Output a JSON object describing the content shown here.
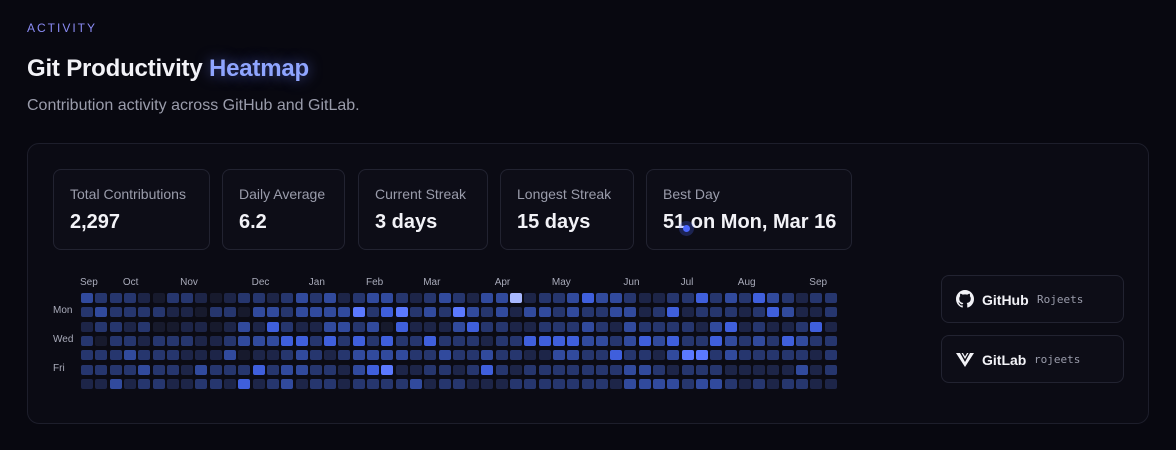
{
  "header": {
    "eyebrow": "ACTIVITY",
    "title_main": "Git Productivity",
    "title_accent": "Heatmap",
    "subtitle": "Contribution activity across GitHub and GitLab."
  },
  "stats": [
    {
      "label": "Total Contributions",
      "value": "2,297"
    },
    {
      "label": "Daily Average",
      "value": "6.2"
    },
    {
      "label": "Current Streak",
      "value": "3 days"
    },
    {
      "label": "Longest Streak",
      "value": "15 days"
    },
    {
      "label": "Best Day",
      "value": "51 on Mon, Mar 16"
    }
  ],
  "heatmap": {
    "months": [
      {
        "label": "Sep",
        "week": 0
      },
      {
        "label": "Oct",
        "week": 3
      },
      {
        "label": "Nov",
        "week": 7
      },
      {
        "label": "Dec",
        "week": 12
      },
      {
        "label": "Jan",
        "week": 16
      },
      {
        "label": "Feb",
        "week": 20
      },
      {
        "label": "Mar",
        "week": 24
      },
      {
        "label": "Apr",
        "week": 29
      },
      {
        "label": "May",
        "week": 33
      },
      {
        "label": "Jun",
        "week": 38
      },
      {
        "label": "Jul",
        "week": 42
      },
      {
        "label": "Aug",
        "week": 46
      },
      {
        "label": "Sep",
        "week": 51
      }
    ],
    "days": [
      {
        "label": "Mon",
        "row": 1
      },
      {
        "label": "Wed",
        "row": 3
      },
      {
        "label": "Fri",
        "row": 5
      }
    ],
    "weeks": 53,
    "levels": [
      "#171a2d",
      "#1d2548",
      "#26366e",
      "#314a9d",
      "#3f5fdc",
      "#5b79ff",
      "#a8b8ff"
    ],
    "grid": [
      "3222102210122123231233212321336122343321122423243212223",
      "2322221102203323333524523253231332322331241222124311",
      "1221200110131421133230411134221122232132222134121124",
      "2022122211233344242424224222122444433234342243232432",
      "2223222111301123212333322322322113322422135523222221",
      "2222322132224233221345112212421222222233212221111131",
      "1131221122141231221222231221112222222133332332121221"
    ]
  },
  "accounts": [
    {
      "name": "GitHub",
      "user": "Rojeets",
      "icon": "github-icon"
    },
    {
      "name": "GitLab",
      "user": "rojeets",
      "icon": "gitlab-icon"
    }
  ]
}
